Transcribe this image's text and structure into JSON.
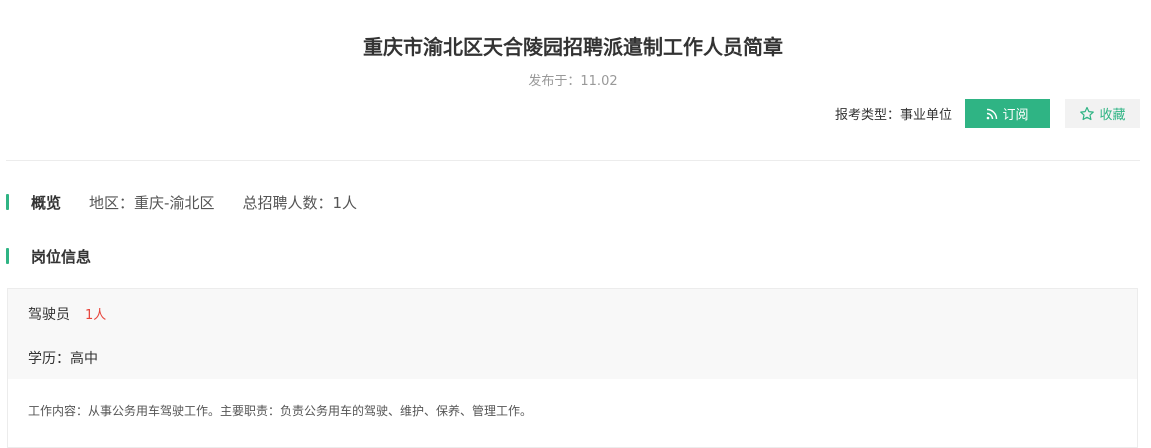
{
  "header": {
    "title": "重庆市渝北区天合陵园招聘派遣制工作人员简章",
    "publish_label": "发布于：",
    "publish_date": "11.02",
    "exam_type_label": "报考类型：",
    "exam_type_value": "事业单位",
    "subscribe_label": "订阅",
    "favorite_label": "收藏"
  },
  "overview": {
    "title": "概览",
    "region_label": "地区：",
    "region_value": "重庆-渝北区",
    "total_label": "总招聘人数：",
    "total_value": "1人"
  },
  "positions": {
    "title": "岗位信息",
    "items": [
      {
        "name": "驾驶员",
        "count": "1人",
        "education_label": "学历：",
        "education_value": "高中",
        "description": "工作内容：从事公务用车驾驶工作。主要职责：负责公务用车的驾驶、维护、保养、管理工作。"
      }
    ]
  },
  "colors": {
    "accent": "#2fb484",
    "count_red": "#e8453c",
    "muted": "#999999"
  },
  "icons": {
    "subscribe": "rss-icon",
    "favorite": "star-outline-icon"
  }
}
